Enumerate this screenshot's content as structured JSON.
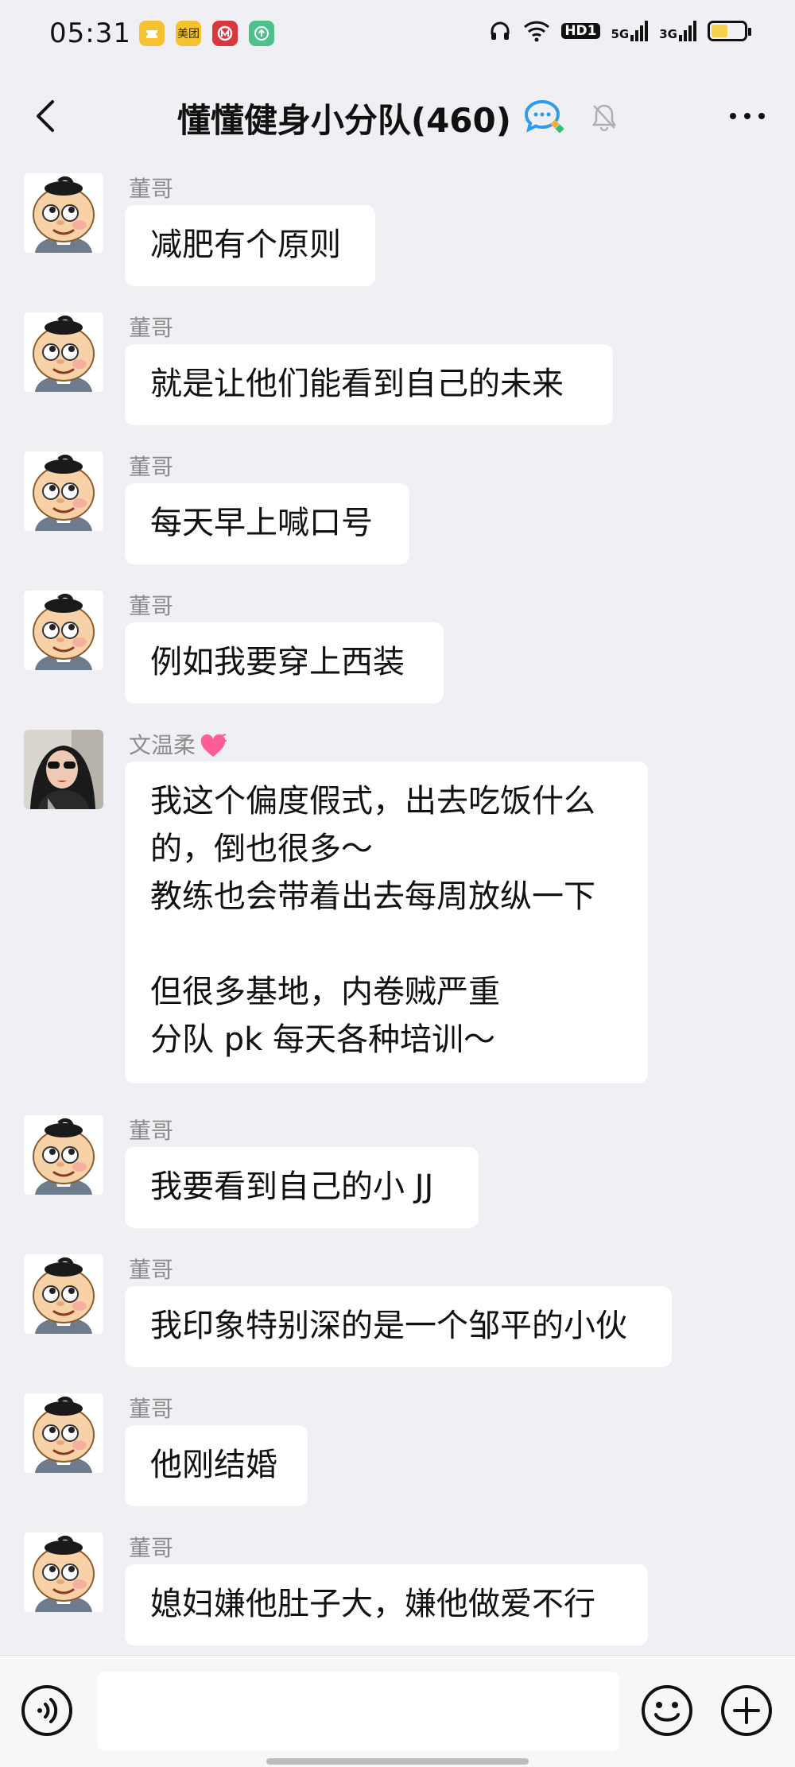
{
  "status_bar": {
    "time": "05:31",
    "app_icons": [
      {
        "name": "coupon-app-icon",
        "color": "#f7c232",
        "label": ""
      },
      {
        "name": "meituan-app-icon",
        "color": "#f7c232",
        "label": "美团"
      },
      {
        "name": "bank-app-icon",
        "color": "#d9363e",
        "label": ""
      },
      {
        "name": "upload-app-icon",
        "color": "#4cc18c",
        "label": ""
      }
    ],
    "hd_badge": "HD1",
    "network_1": "5G",
    "network_2": "3G",
    "battery_level": 0.45,
    "battery_color": "#f5d04b"
  },
  "header": {
    "title": "懂懂健身小分队(460)",
    "icons": [
      "back-icon",
      "group-chat-icon",
      "mute-bell-icon",
      "more-icon"
    ]
  },
  "messages": [
    {
      "sender": "董哥",
      "text": "减肥有个原则",
      "avatar": "cartoon-boy"
    },
    {
      "sender": "董哥",
      "text": "就是让他们能看到自己的未来",
      "avatar": "cartoon-boy"
    },
    {
      "sender": "董哥",
      "text": "每天早上喊口号",
      "avatar": "cartoon-boy"
    },
    {
      "sender": "董哥",
      "text": "例如我要穿上西装",
      "avatar": "cartoon-boy"
    },
    {
      "sender": "文温柔",
      "text": "我这个偏度假式，出去吃饭什么\n的，倒也很多～\n教练也会带着出去每周放纵一下\n\n但很多基地，内卷贼严重\n分队 pk 每天各种培训～",
      "avatar": "photo-woman",
      "badge_icon": "heart-icon"
    },
    {
      "sender": "董哥",
      "text": "我要看到自己的小 JJ",
      "avatar": "cartoon-boy"
    },
    {
      "sender": "董哥",
      "text": "我印象特别深的是一个邹平的小伙",
      "avatar": "cartoon-boy"
    },
    {
      "sender": "董哥",
      "text": "他刚结婚",
      "avatar": "cartoon-boy"
    },
    {
      "sender": "董哥",
      "text": "媳妇嫌他肚子大，嫌他做爱不行",
      "avatar": "cartoon-boy"
    }
  ],
  "input_bar": {
    "icons": [
      "voice-icon",
      "emoji-icon",
      "plus-icon"
    ],
    "text_value": ""
  }
}
